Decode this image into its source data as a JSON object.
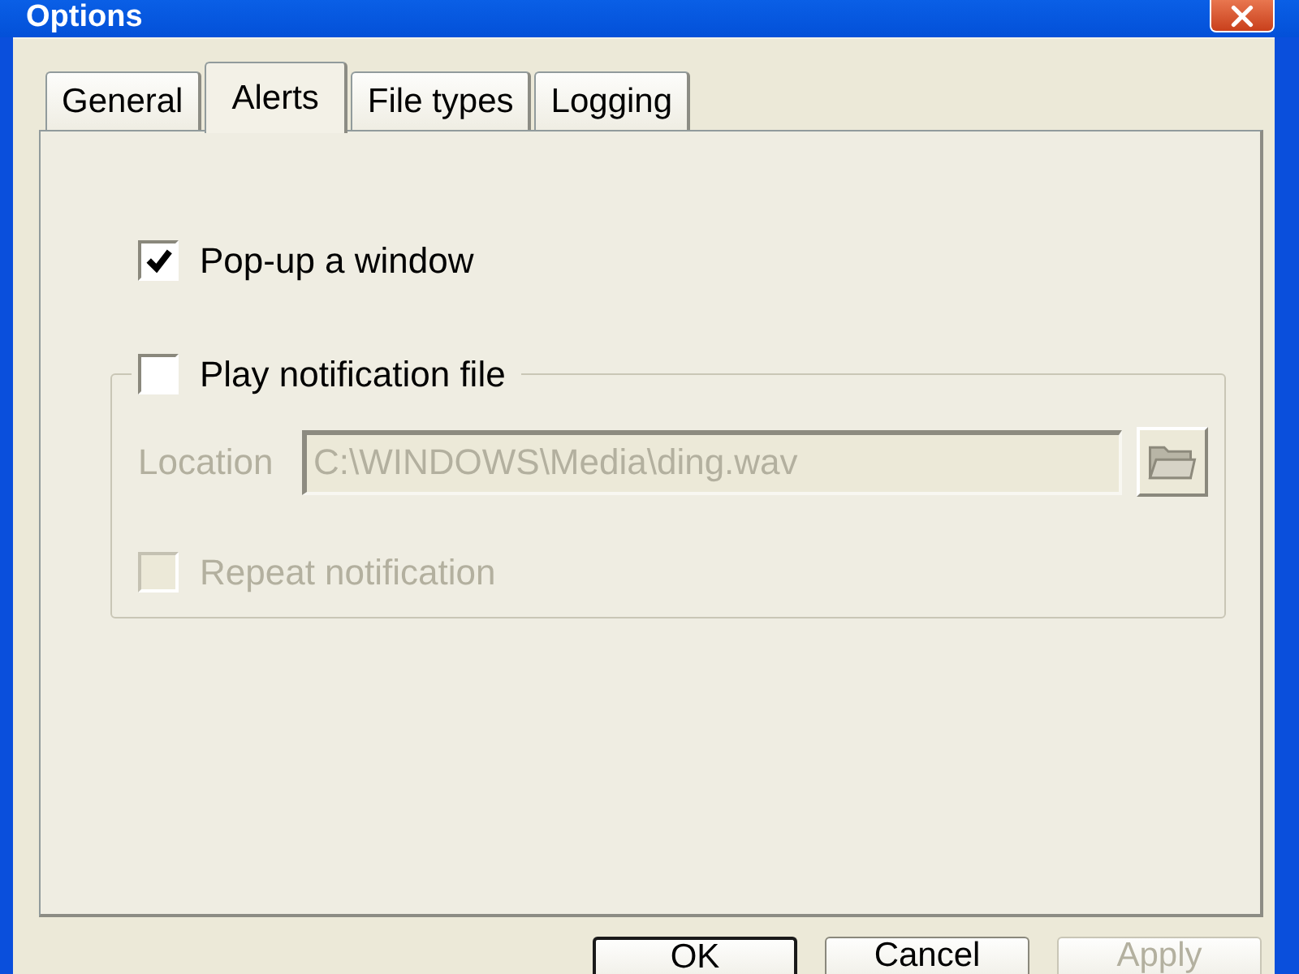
{
  "window": {
    "title": "Options"
  },
  "tabs": [
    {
      "label": "General",
      "selected": false
    },
    {
      "label": "Alerts",
      "selected": true
    },
    {
      "label": "File types",
      "selected": false
    },
    {
      "label": "Logging",
      "selected": false
    }
  ],
  "alerts": {
    "popup": {
      "label": "Pop-up a window",
      "checked": true
    },
    "notification": {
      "label": "Play notification file",
      "checked": false,
      "location": {
        "label": "Location",
        "value": "C:\\WINDOWS\\Media\\ding.wav",
        "disabled": true
      },
      "repeat": {
        "label": "Repeat notification",
        "checked": false,
        "disabled": true
      }
    }
  },
  "buttons": [
    {
      "label": "OK",
      "default": true,
      "disabled": false
    },
    {
      "label": "Cancel",
      "default": false,
      "disabled": false
    },
    {
      "label": "Apply",
      "default": false,
      "disabled": true
    }
  ]
}
